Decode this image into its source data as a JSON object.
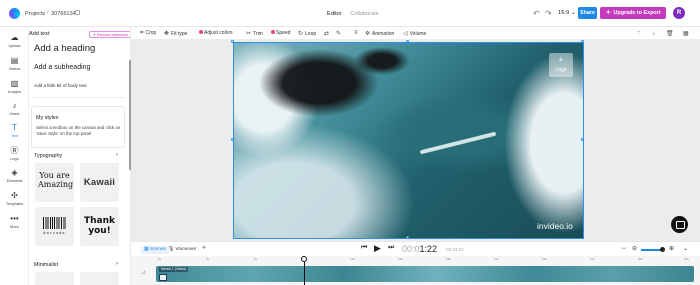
{
  "header": {
    "projects": "Projects",
    "separator": "/",
    "project_name": "30766134",
    "tabs": [
      "Editor",
      "Collaborate"
    ],
    "aspect_ratio": "16:9",
    "share": "Share",
    "upgrade": "Upgrade to Export",
    "avatar_initial": "R"
  },
  "rail": [
    {
      "label": "Upload",
      "icon": "cloud-upload-icon"
    },
    {
      "label": "Videos",
      "icon": "film-icon"
    },
    {
      "label": "Images",
      "icon": "image-icon"
    },
    {
      "label": "Music",
      "icon": "music-note-icon"
    },
    {
      "label": "Text",
      "icon": "text-icon"
    },
    {
      "label": "Logo",
      "icon": "logo-r-icon"
    },
    {
      "label": "Elements",
      "icon": "shapes-icon"
    },
    {
      "label": "Templates",
      "icon": "templates-icon"
    },
    {
      "label": "More",
      "icon": "more-dots-icon"
    }
  ],
  "panel": {
    "title": "Add text",
    "remove_watermark": "Remove watermark",
    "heading": "Add a heading",
    "subheading": "Add a subheading",
    "body": "Add a little bit of body text",
    "my_styles_title": "My styles",
    "my_styles_desc": "Select a textbox on the canvas and click on 'Save Style' on the top panel",
    "typography": "Typography",
    "minimalist": "Minimalist",
    "cards": {
      "amazing": "You are Amazing!",
      "kawaii": "Kawaii",
      "barcode": "barcode",
      "thank_you": "Thank you!"
    }
  },
  "toolbar": {
    "crop": "Crop",
    "fit_type": "Fit type",
    "adjust_colors": "Adjust colors",
    "trim": "Trim",
    "speed": "Speed",
    "loop": "Loop",
    "animation": "Animation",
    "volume": "Volume"
  },
  "canvas": {
    "logo_placeholder": "Logo",
    "watermark": "invideo.io"
  },
  "playback": {
    "scenes": "Scenes",
    "voiceover": "Voiceover",
    "current_time_dim": "00:0",
    "current_time": "1:22",
    "total_time": "00:33:01",
    "zoom_level": 0.85
  },
  "timeline": {
    "clip_label": "Media 1 (Video)",
    "ruler": [
      "0s",
      "3s",
      "6s",
      "9s",
      "12s",
      "15s",
      "18s",
      "21s",
      "24s",
      "27s",
      "30s",
      "33s"
    ]
  },
  "colors": {
    "accent": "#1e88e5",
    "upgrade": "#c53bbd",
    "avatar": "#7b2cbf"
  }
}
